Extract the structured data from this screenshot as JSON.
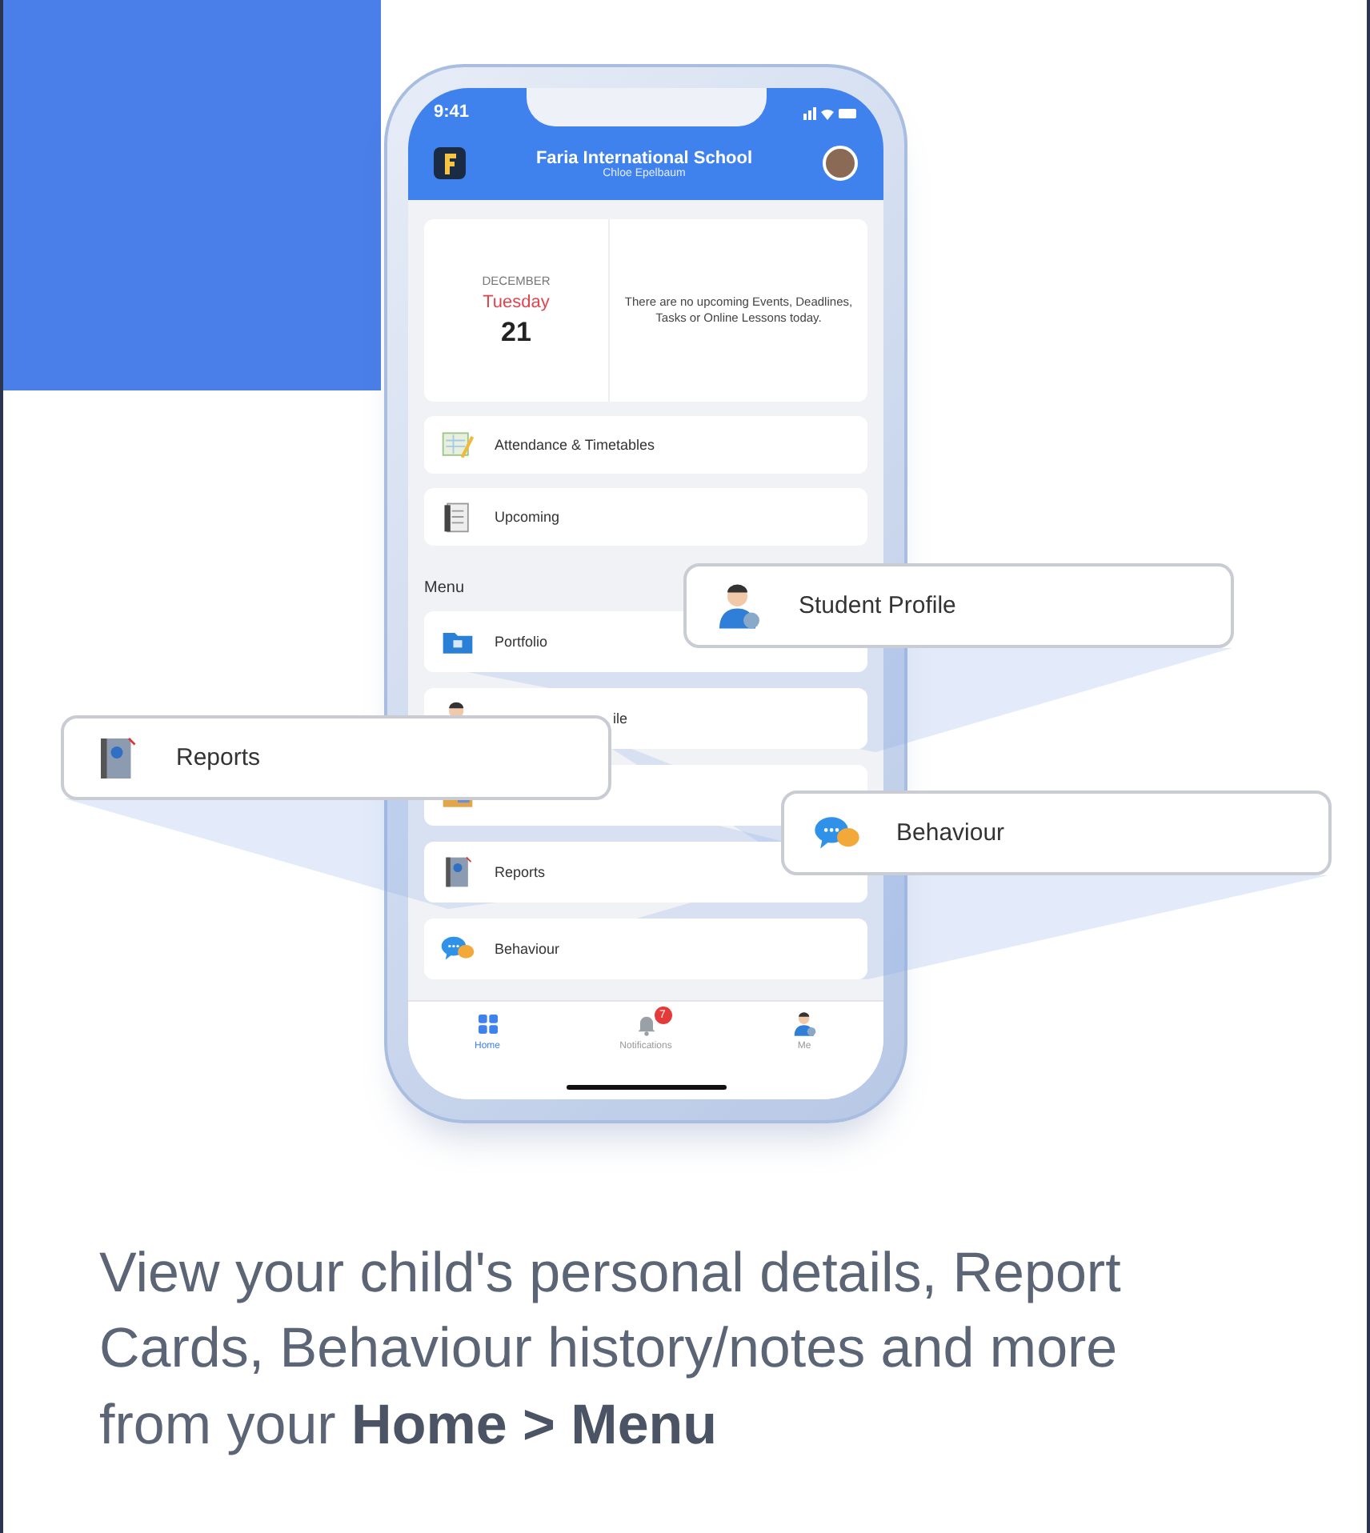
{
  "phone": {
    "status_bar": {
      "time": "9:41"
    },
    "header": {
      "title": "Faria International School",
      "subtitle": "Chloe Epelbaum"
    },
    "date_card": {
      "month": "DECEMBER",
      "weekday": "Tuesday",
      "day": "21",
      "message": "There are no upcoming Events, Deadlines, Tasks or Online Lessons today."
    },
    "shortcuts": [
      {
        "label": "Attendance & Timetables",
        "kind": "timetable"
      },
      {
        "label": "Upcoming",
        "kind": "notes"
      }
    ],
    "menu": {
      "title": "Menu",
      "items": [
        {
          "label": "Portfolio",
          "kind": "folder",
          "covered": false
        },
        {
          "label": "ile",
          "kind": "person",
          "covered": true
        },
        {
          "kind": "planner"
        },
        {
          "label": "Reports",
          "kind": "report",
          "covered": false
        },
        {
          "label": "Behaviour",
          "kind": "chat",
          "covered": false
        }
      ]
    },
    "tab_bar": [
      {
        "label": "Home",
        "kind": "grid",
        "selected": true
      },
      {
        "label": "Notifications",
        "kind": "bell",
        "selected": false,
        "badge": "7"
      },
      {
        "label": "Me",
        "kind": "person",
        "selected": false
      }
    ]
  },
  "callouts": [
    {
      "label": "Student Profile",
      "kind": "person"
    },
    {
      "label": "Reports",
      "kind": "report"
    },
    {
      "label": "Behaviour",
      "kind": "chat"
    }
  ],
  "caption": "View your child's personal details, Report Cards, Behaviour history/notes and more from your **Home > Menu**"
}
